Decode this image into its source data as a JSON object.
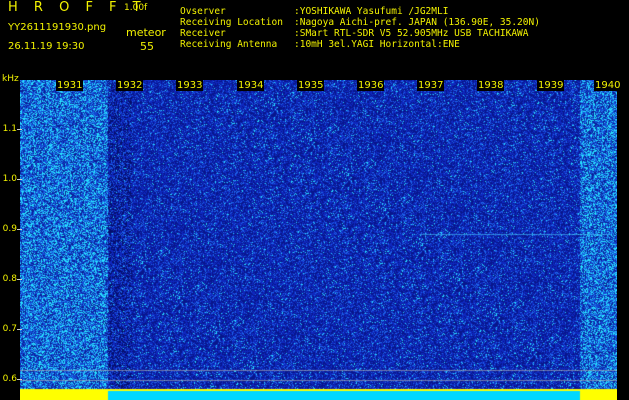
{
  "header": {
    "app_title": "H R O F F T",
    "version": "1.00f",
    "filename": "YY2611191930.png",
    "datetime": "26.11.19 19:30",
    "mode": "meteor",
    "count": "55"
  },
  "info": [
    {
      "label": "Ovserver",
      "value": ":YOSHIKAWA Yasufumi /JG2MLI"
    },
    {
      "label": "Receiving Location",
      "value": ":Nagoya Aichi-pref. JAPAN (136.90E, 35.20N)"
    },
    {
      "label": "Receiver",
      "value": ":SMart RTL-SDR V5 52.905MHz USB TACHIKAWA"
    },
    {
      "label": "Receiving Antenna",
      "value": ":10mH 3el.YAGI Horizontal:ENE"
    }
  ],
  "axis": {
    "y_unit": "kHz",
    "y_ticks": [
      "1.1",
      "1.0",
      "0.9",
      "0.8",
      "0.7",
      "0.6"
    ],
    "x_ticks": [
      "1931",
      "1932",
      "1933",
      "1934",
      "1935",
      "1936",
      "1937",
      "1938",
      "1939",
      "1940"
    ]
  },
  "colors": {
    "text": "#f2f200",
    "background": "#000000",
    "baseline": "#ffff00"
  }
}
